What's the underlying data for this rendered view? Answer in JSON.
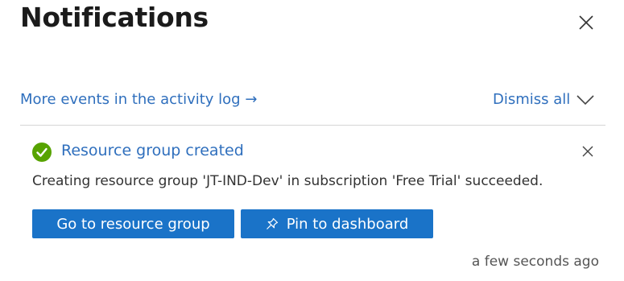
{
  "header": {
    "title": "Notifications",
    "close_icon": "close-icon"
  },
  "toolbar": {
    "activity_log_link": "More events in the activity log →",
    "dismiss_all": "Dismiss all",
    "expand_icon": "chevron-down-icon"
  },
  "notification": {
    "status_icon": "check-circle-icon",
    "status_color": "#57a300",
    "title": "Resource group created",
    "message": "Creating resource group 'JT-IND-Dev' in subscription 'Free Trial' succeeded.",
    "close_icon": "close-icon",
    "primary_button": "Go to resource group",
    "pin_button": "Pin to dashboard",
    "pin_icon": "pin-icon",
    "timestamp": "a few seconds ago"
  },
  "colors": {
    "link": "#2f6fbd",
    "button": "#1a73c8",
    "success": "#57a300"
  }
}
